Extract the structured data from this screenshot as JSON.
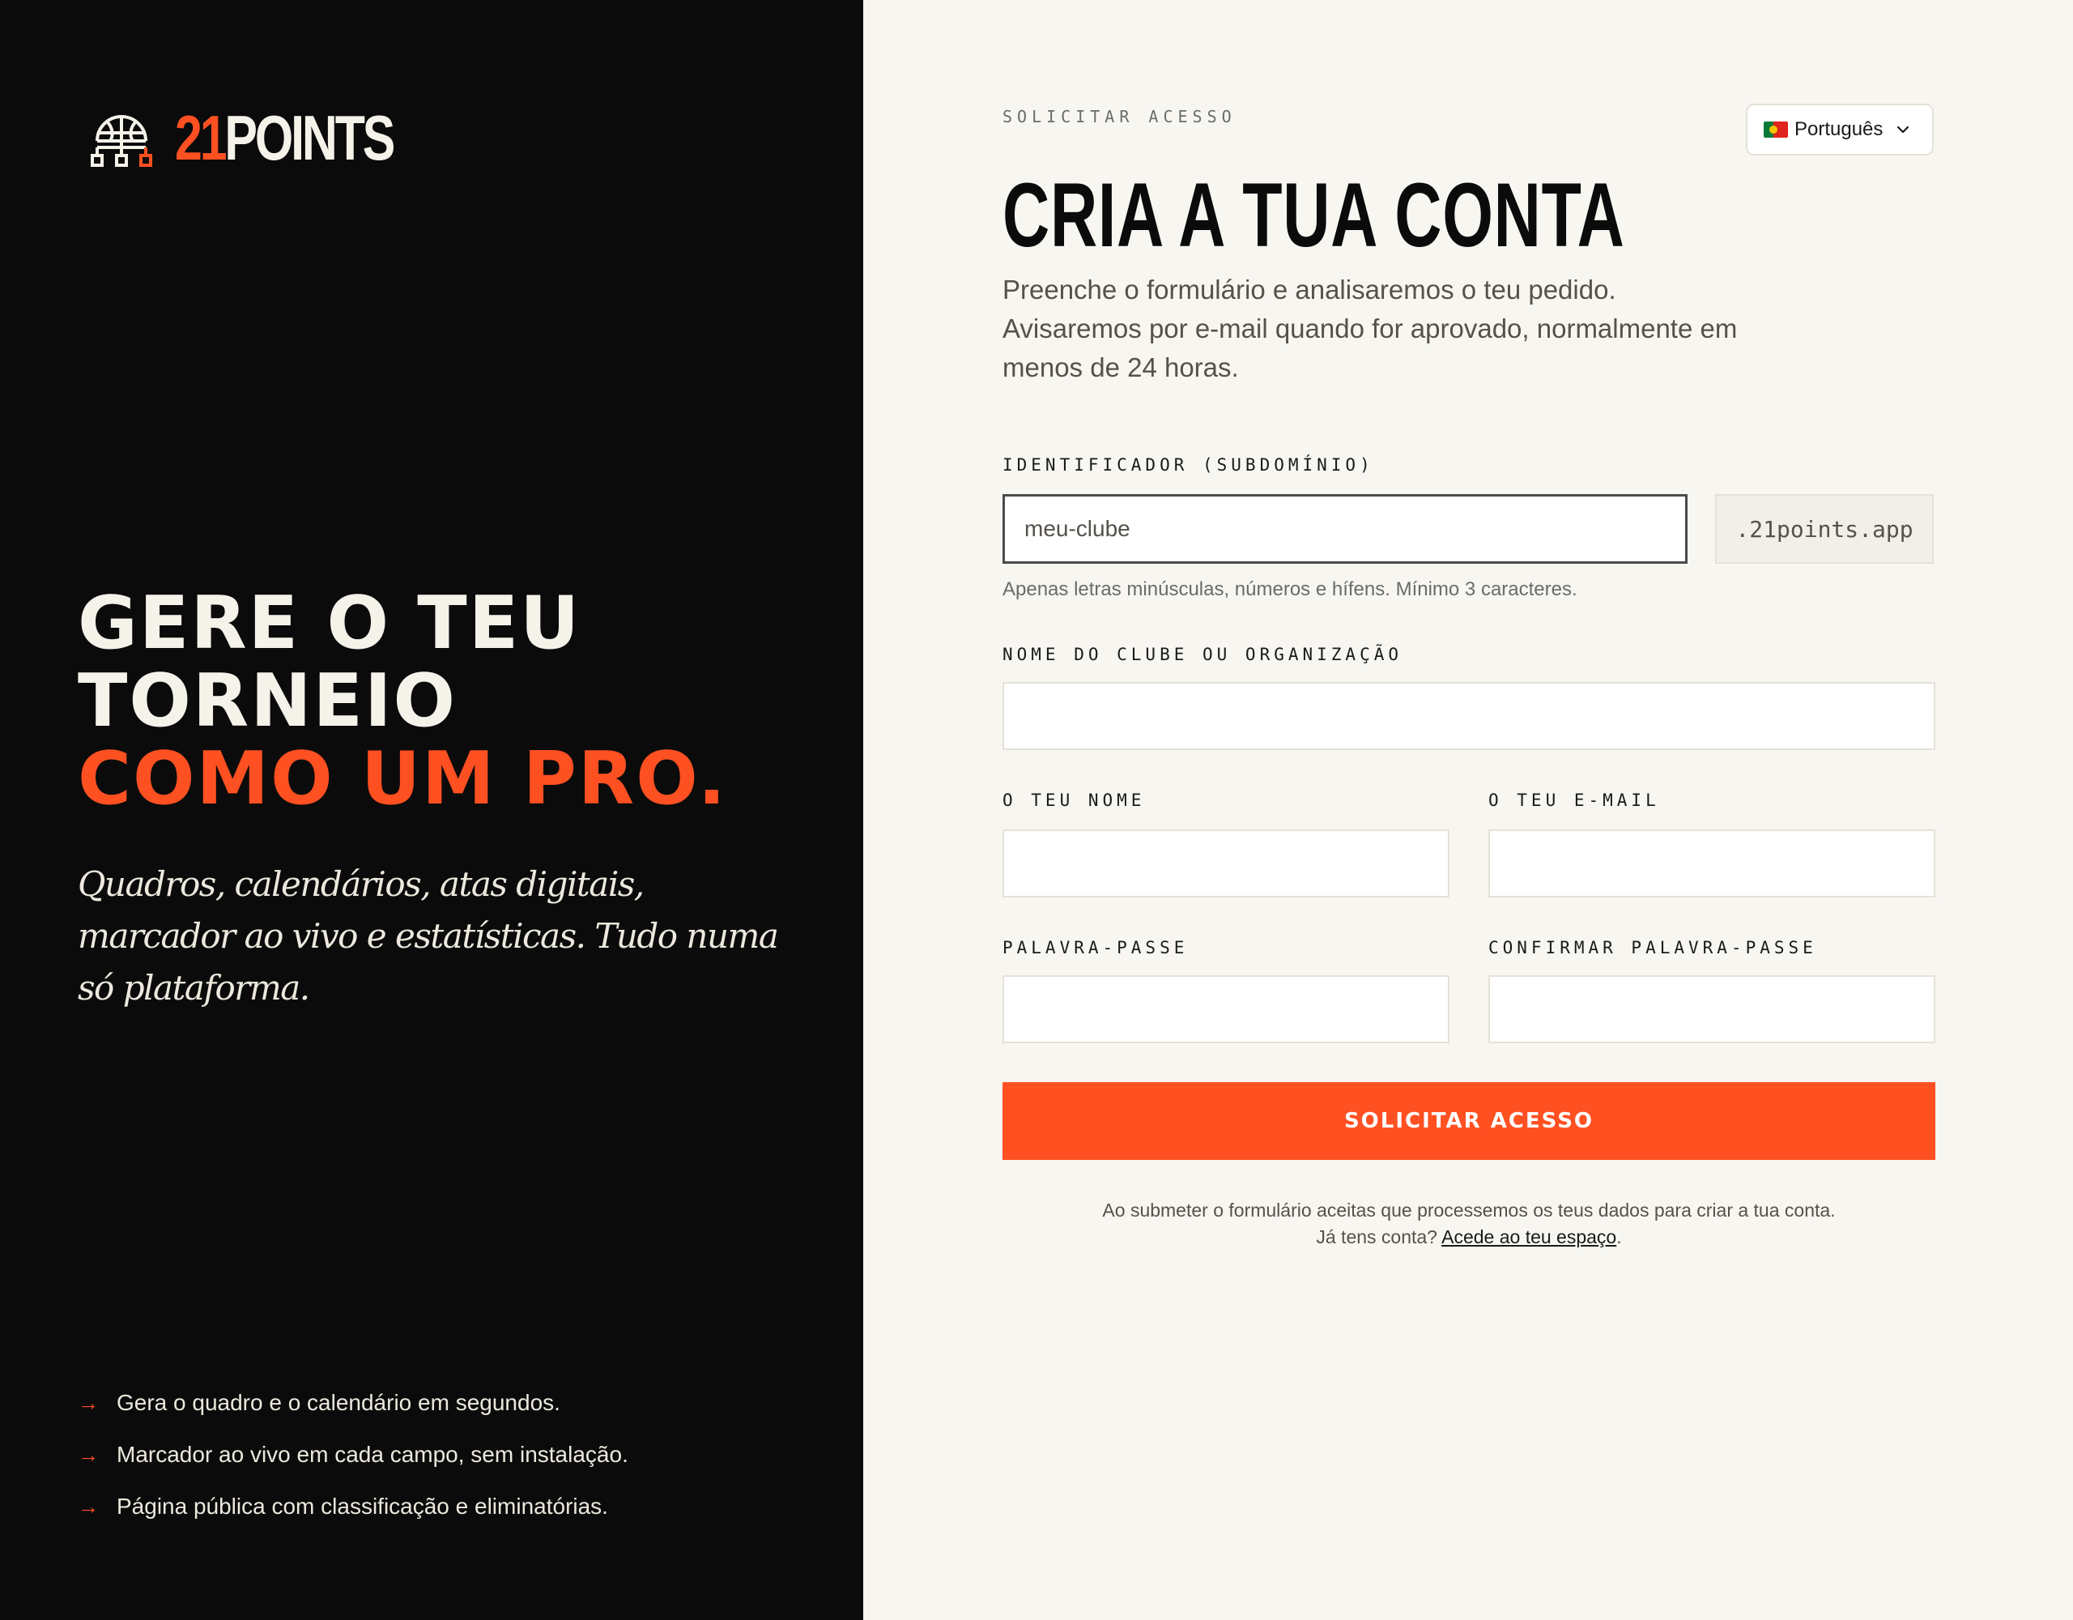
{
  "brand": {
    "name_accent": "21",
    "name_rest": "POINTS"
  },
  "hero": {
    "line1": "GERE O TEU",
    "line2": "TORNEIO",
    "line3": "COMO UM PRO.",
    "subtitle": "Quadros, calendários, atas digitais, marcador ao vivo e estatísticas. Tudo numa só plataforma."
  },
  "features": [
    {
      "arrow": "→",
      "text": "Gera o quadro e o calendário em segundos."
    },
    {
      "arrow": "→",
      "text": "Marcador ao vivo em cada campo, sem instalação."
    },
    {
      "arrow": "→",
      "text": "Página pública com classificação e eliminatórias."
    }
  ],
  "form": {
    "eyebrow": "SOLICITAR ACESSO",
    "language": "Português",
    "title": "CRIA A TUA CONTA",
    "intro": "Preenche o formulário e analisaremos o teu pedido. Avisaremos por e-mail quando for aprovado, normalmente em menos de 24 horas.",
    "subdomain": {
      "label": "IDENTIFICADOR (SUBDOMÍNIO)",
      "placeholder": "meu-clube",
      "suffix": ".21points.app",
      "hint": "Apenas letras minúsculas, números e hífens. Mínimo 3 caracteres."
    },
    "club": {
      "label": "NOME DO CLUBE OU ORGANIZAÇÃO"
    },
    "name": {
      "label": "O TEU NOME"
    },
    "email": {
      "label": "O TEU E-MAIL"
    },
    "password": {
      "label": "PALAVRA-PASSE"
    },
    "confirm_password": {
      "label": "CONFIRMAR PALAVRA-PASSE"
    },
    "submit_label": "SOLICITAR ACESSO",
    "legal_line1": "Ao submeter o formulário aceitas que processemos os teus dados para criar a tua conta.",
    "legal_line2_prefix": "Já tens conta?",
    "legal_link": "Acede ao teu espaço",
    "legal_suffix": "."
  },
  "colors": {
    "accent": "#ff5022",
    "dark": "#0b0b0b",
    "paper": "#f8f6f1"
  },
  "icons": [
    "basketball-bracket-icon",
    "portugal-flag-icon",
    "chevron-down-icon",
    "arrow-right-icon"
  ]
}
